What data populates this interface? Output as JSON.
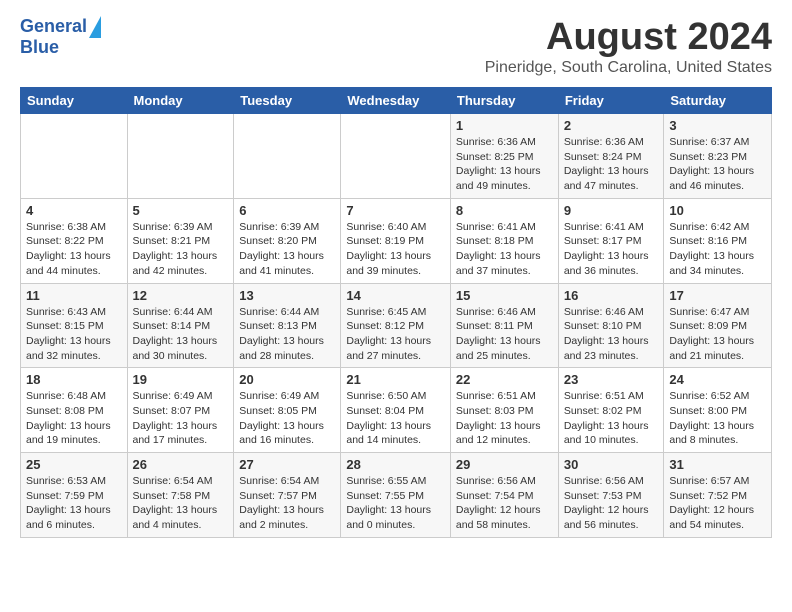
{
  "header": {
    "logo_line1": "General",
    "logo_line2": "Blue",
    "month_title": "August 2024",
    "location": "Pineridge, South Carolina, United States"
  },
  "weekdays": [
    "Sunday",
    "Monday",
    "Tuesday",
    "Wednesday",
    "Thursday",
    "Friday",
    "Saturday"
  ],
  "weeks": [
    [
      {
        "day": "",
        "info": ""
      },
      {
        "day": "",
        "info": ""
      },
      {
        "day": "",
        "info": ""
      },
      {
        "day": "",
        "info": ""
      },
      {
        "day": "1",
        "info": "Sunrise: 6:36 AM\nSunset: 8:25 PM\nDaylight: 13 hours\nand 49 minutes."
      },
      {
        "day": "2",
        "info": "Sunrise: 6:36 AM\nSunset: 8:24 PM\nDaylight: 13 hours\nand 47 minutes."
      },
      {
        "day": "3",
        "info": "Sunrise: 6:37 AM\nSunset: 8:23 PM\nDaylight: 13 hours\nand 46 minutes."
      }
    ],
    [
      {
        "day": "4",
        "info": "Sunrise: 6:38 AM\nSunset: 8:22 PM\nDaylight: 13 hours\nand 44 minutes."
      },
      {
        "day": "5",
        "info": "Sunrise: 6:39 AM\nSunset: 8:21 PM\nDaylight: 13 hours\nand 42 minutes."
      },
      {
        "day": "6",
        "info": "Sunrise: 6:39 AM\nSunset: 8:20 PM\nDaylight: 13 hours\nand 41 minutes."
      },
      {
        "day": "7",
        "info": "Sunrise: 6:40 AM\nSunset: 8:19 PM\nDaylight: 13 hours\nand 39 minutes."
      },
      {
        "day": "8",
        "info": "Sunrise: 6:41 AM\nSunset: 8:18 PM\nDaylight: 13 hours\nand 37 minutes."
      },
      {
        "day": "9",
        "info": "Sunrise: 6:41 AM\nSunset: 8:17 PM\nDaylight: 13 hours\nand 36 minutes."
      },
      {
        "day": "10",
        "info": "Sunrise: 6:42 AM\nSunset: 8:16 PM\nDaylight: 13 hours\nand 34 minutes."
      }
    ],
    [
      {
        "day": "11",
        "info": "Sunrise: 6:43 AM\nSunset: 8:15 PM\nDaylight: 13 hours\nand 32 minutes."
      },
      {
        "day": "12",
        "info": "Sunrise: 6:44 AM\nSunset: 8:14 PM\nDaylight: 13 hours\nand 30 minutes."
      },
      {
        "day": "13",
        "info": "Sunrise: 6:44 AM\nSunset: 8:13 PM\nDaylight: 13 hours\nand 28 minutes."
      },
      {
        "day": "14",
        "info": "Sunrise: 6:45 AM\nSunset: 8:12 PM\nDaylight: 13 hours\nand 27 minutes."
      },
      {
        "day": "15",
        "info": "Sunrise: 6:46 AM\nSunset: 8:11 PM\nDaylight: 13 hours\nand 25 minutes."
      },
      {
        "day": "16",
        "info": "Sunrise: 6:46 AM\nSunset: 8:10 PM\nDaylight: 13 hours\nand 23 minutes."
      },
      {
        "day": "17",
        "info": "Sunrise: 6:47 AM\nSunset: 8:09 PM\nDaylight: 13 hours\nand 21 minutes."
      }
    ],
    [
      {
        "day": "18",
        "info": "Sunrise: 6:48 AM\nSunset: 8:08 PM\nDaylight: 13 hours\nand 19 minutes."
      },
      {
        "day": "19",
        "info": "Sunrise: 6:49 AM\nSunset: 8:07 PM\nDaylight: 13 hours\nand 17 minutes."
      },
      {
        "day": "20",
        "info": "Sunrise: 6:49 AM\nSunset: 8:05 PM\nDaylight: 13 hours\nand 16 minutes."
      },
      {
        "day": "21",
        "info": "Sunrise: 6:50 AM\nSunset: 8:04 PM\nDaylight: 13 hours\nand 14 minutes."
      },
      {
        "day": "22",
        "info": "Sunrise: 6:51 AM\nSunset: 8:03 PM\nDaylight: 13 hours\nand 12 minutes."
      },
      {
        "day": "23",
        "info": "Sunrise: 6:51 AM\nSunset: 8:02 PM\nDaylight: 13 hours\nand 10 minutes."
      },
      {
        "day": "24",
        "info": "Sunrise: 6:52 AM\nSunset: 8:00 PM\nDaylight: 13 hours\nand 8 minutes."
      }
    ],
    [
      {
        "day": "25",
        "info": "Sunrise: 6:53 AM\nSunset: 7:59 PM\nDaylight: 13 hours\nand 6 minutes."
      },
      {
        "day": "26",
        "info": "Sunrise: 6:54 AM\nSunset: 7:58 PM\nDaylight: 13 hours\nand 4 minutes."
      },
      {
        "day": "27",
        "info": "Sunrise: 6:54 AM\nSunset: 7:57 PM\nDaylight: 13 hours\nand 2 minutes."
      },
      {
        "day": "28",
        "info": "Sunrise: 6:55 AM\nSunset: 7:55 PM\nDaylight: 13 hours\nand 0 minutes."
      },
      {
        "day": "29",
        "info": "Sunrise: 6:56 AM\nSunset: 7:54 PM\nDaylight: 12 hours\nand 58 minutes."
      },
      {
        "day": "30",
        "info": "Sunrise: 6:56 AM\nSunset: 7:53 PM\nDaylight: 12 hours\nand 56 minutes."
      },
      {
        "day": "31",
        "info": "Sunrise: 6:57 AM\nSunset: 7:52 PM\nDaylight: 12 hours\nand 54 minutes."
      }
    ]
  ]
}
